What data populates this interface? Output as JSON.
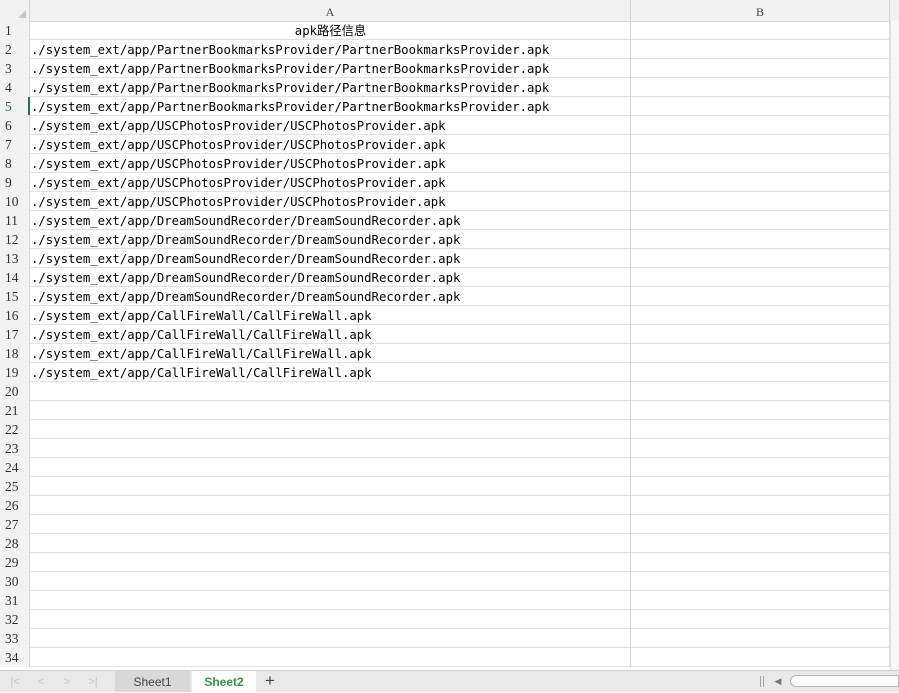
{
  "columns": [
    "A",
    "B"
  ],
  "rows": [
    {
      "num": "1",
      "a": "apk路径信息"
    },
    {
      "num": "2",
      "a": "./system_ext/app/PartnerBookmarksProvider/PartnerBookmarksProvider.apk"
    },
    {
      "num": "3",
      "a": "./system_ext/app/PartnerBookmarksProvider/PartnerBookmarksProvider.apk"
    },
    {
      "num": "4",
      "a": "./system_ext/app/PartnerBookmarksProvider/PartnerBookmarksProvider.apk"
    },
    {
      "num": "5",
      "a": "./system_ext/app/PartnerBookmarksProvider/PartnerBookmarksProvider.apk"
    },
    {
      "num": "6",
      "a": "./system_ext/app/USCPhotosProvider/USCPhotosProvider.apk"
    },
    {
      "num": "7",
      "a": "./system_ext/app/USCPhotosProvider/USCPhotosProvider.apk"
    },
    {
      "num": "8",
      "a": "./system_ext/app/USCPhotosProvider/USCPhotosProvider.apk"
    },
    {
      "num": "9",
      "a": "./system_ext/app/USCPhotosProvider/USCPhotosProvider.apk"
    },
    {
      "num": "10",
      "a": "./system_ext/app/USCPhotosProvider/USCPhotosProvider.apk"
    },
    {
      "num": "11",
      "a": "./system_ext/app/DreamSoundRecorder/DreamSoundRecorder.apk"
    },
    {
      "num": "12",
      "a": "./system_ext/app/DreamSoundRecorder/DreamSoundRecorder.apk"
    },
    {
      "num": "13",
      "a": "./system_ext/app/DreamSoundRecorder/DreamSoundRecorder.apk"
    },
    {
      "num": "14",
      "a": "./system_ext/app/DreamSoundRecorder/DreamSoundRecorder.apk"
    },
    {
      "num": "15",
      "a": "./system_ext/app/DreamSoundRecorder/DreamSoundRecorder.apk"
    },
    {
      "num": "16",
      "a": "./system_ext/app/CallFireWall/CallFireWall.apk"
    },
    {
      "num": "17",
      "a": "./system_ext/app/CallFireWall/CallFireWall.apk"
    },
    {
      "num": "18",
      "a": "./system_ext/app/CallFireWall/CallFireWall.apk"
    },
    {
      "num": "19",
      "a": "./system_ext/app/CallFireWall/CallFireWall.apk"
    },
    {
      "num": "20",
      "a": ""
    },
    {
      "num": "21",
      "a": ""
    },
    {
      "num": "22",
      "a": ""
    },
    {
      "num": "23",
      "a": ""
    },
    {
      "num": "24",
      "a": ""
    },
    {
      "num": "25",
      "a": ""
    },
    {
      "num": "26",
      "a": ""
    },
    {
      "num": "27",
      "a": ""
    },
    {
      "num": "28",
      "a": ""
    },
    {
      "num": "29",
      "a": ""
    },
    {
      "num": "30",
      "a": ""
    },
    {
      "num": "31",
      "a": ""
    },
    {
      "num": "32",
      "a": ""
    },
    {
      "num": "33",
      "a": ""
    },
    {
      "num": "34",
      "a": ""
    }
  ],
  "active_row": "5",
  "sheets": [
    {
      "name": "Sheet1",
      "active": false
    },
    {
      "name": "Sheet2",
      "active": true
    }
  ],
  "tabbar": {
    "add_label": "+",
    "nav_icons": [
      "first-sheet-icon",
      "prev-sheet-icon",
      "next-sheet-icon",
      "last-sheet-icon"
    ]
  },
  "colors": {
    "active_accent": "#227447",
    "active_tab_text": "#2e9a44",
    "header_bg": "#f2f2f2",
    "gridline": "#e1e1e1"
  }
}
